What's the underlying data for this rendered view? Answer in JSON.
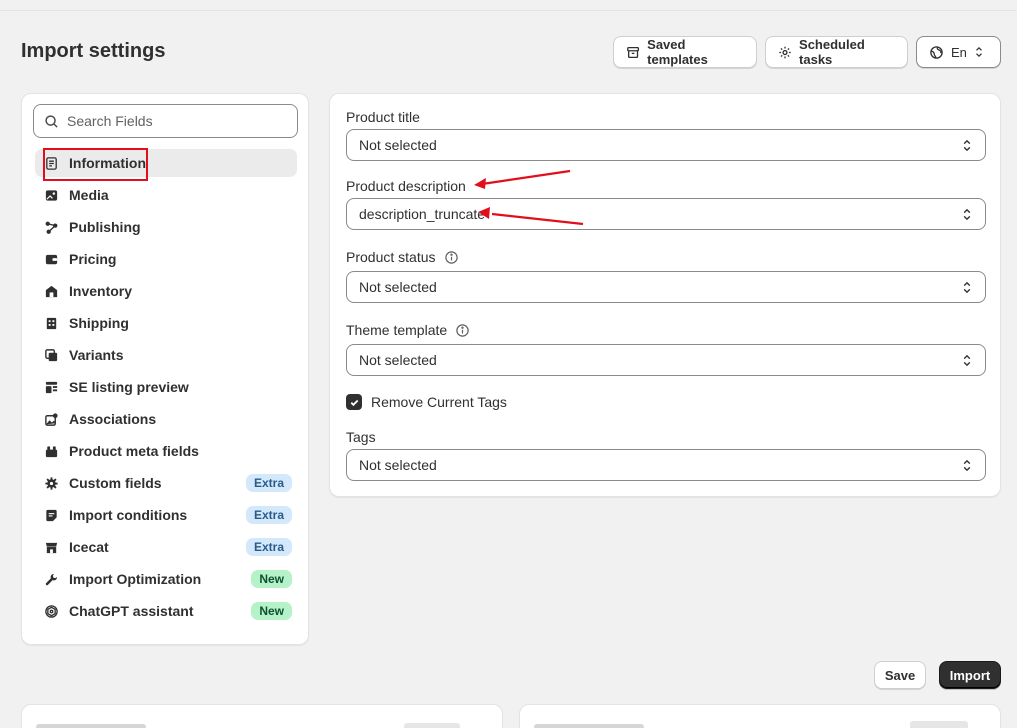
{
  "header": {
    "title": "Import settings",
    "buttons": {
      "saved_templates": "Saved templates",
      "scheduled_tasks": "Scheduled tasks",
      "language": "En"
    }
  },
  "sidebar": {
    "search_placeholder": "Search Fields",
    "items": [
      {
        "label": "Information",
        "icon": "document-icon",
        "active": true
      },
      {
        "label": "Media",
        "icon": "image-icon"
      },
      {
        "label": "Publishing",
        "icon": "network-icon"
      },
      {
        "label": "Pricing",
        "icon": "wallet-icon"
      },
      {
        "label": "Inventory",
        "icon": "warehouse-icon"
      },
      {
        "label": "Shipping",
        "icon": "building-icon"
      },
      {
        "label": "Variants",
        "icon": "variants-icon"
      },
      {
        "label": "SE listing preview",
        "icon": "preview-icon"
      },
      {
        "label": "Associations",
        "icon": "associations-icon"
      },
      {
        "label": "Product meta fields",
        "icon": "metafields-icon"
      },
      {
        "label": "Custom fields",
        "icon": "gear-icon",
        "badge": "Extra"
      },
      {
        "label": "Import conditions",
        "icon": "note-icon",
        "badge": "Extra"
      },
      {
        "label": "Icecat",
        "icon": "store-icon",
        "badge": "Extra"
      },
      {
        "label": "Import Optimization",
        "icon": "wrench-icon",
        "badge": "New"
      },
      {
        "label": "ChatGPT assistant",
        "icon": "chatgpt-icon",
        "badge": "New"
      }
    ]
  },
  "form": {
    "product_title": {
      "label": "Product title",
      "value": "Not selected"
    },
    "product_description": {
      "label": "Product description",
      "value": "description_truncate"
    },
    "product_status": {
      "label": "Product status",
      "value": "Not selected"
    },
    "theme_template": {
      "label": "Theme template",
      "value": "Not selected"
    },
    "remove_tags": {
      "label": "Remove Current Tags",
      "checked": true
    },
    "tags": {
      "label": "Tags",
      "value": "Not selected"
    }
  },
  "footer": {
    "save_label": "Save",
    "import_label": "Import"
  },
  "colors": {
    "background": "#f1f1f1",
    "card": "#ffffff",
    "primary": "#303030",
    "annotation_red": "#e0101a",
    "badge_extra": "#d4e8fb",
    "badge_new": "#b6f2c8"
  }
}
